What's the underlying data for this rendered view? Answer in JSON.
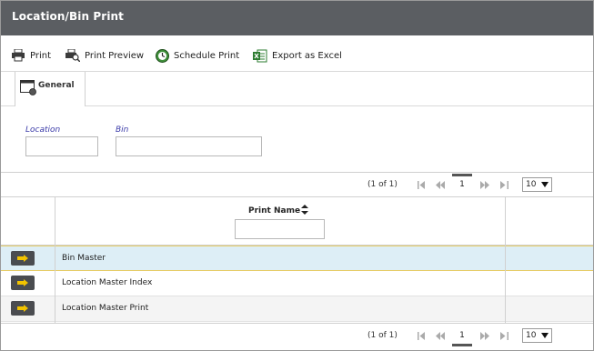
{
  "window": {
    "title": "Location/Bin Print"
  },
  "toolbar": {
    "print_label": "Print",
    "print_preview_label": "Print Preview",
    "schedule_print_label": "Schedule Print",
    "export_excel_label": "Export as Excel"
  },
  "tabs": [
    {
      "label": "General"
    }
  ],
  "form": {
    "location_label": "Location",
    "location_value": "",
    "bin_label": "Bin",
    "bin_value": ""
  },
  "pager": {
    "info": "(1 of 1)",
    "current_page": "1",
    "page_size": "10"
  },
  "grid": {
    "column_header": "Print Name",
    "filter_value": "",
    "rows": [
      {
        "name": "Bin Master",
        "selected": true
      },
      {
        "name": "Location Master Index",
        "selected": false
      },
      {
        "name": "Location Master Print",
        "selected": false
      }
    ]
  },
  "colors": {
    "titlebar": "#5b5e62",
    "label_blue": "#3a3aa8",
    "selected_row": "#ddeef6",
    "select_button": "#4a4c50",
    "arrow_yellow": "#f2c300"
  }
}
